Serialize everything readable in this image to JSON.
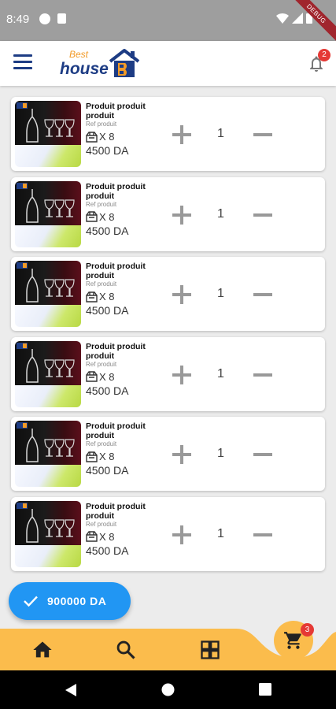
{
  "status_bar": {
    "time": "8:49",
    "debug_ribbon": "DEBUG"
  },
  "app_bar": {
    "logo_best": "Best",
    "logo_house": "house",
    "notification_count": "2"
  },
  "colors": {
    "brand_blue": "#1d3c84",
    "brand_orange": "#f29a26",
    "accent_blue": "#2196f3",
    "nav_yellow": "#fbbc4c",
    "badge_red": "#e53935"
  },
  "cart_items": [
    {
      "name": "Produit produit produit",
      "ref": "Ref produit",
      "pack_count": "X 8",
      "price": "4500 DA",
      "quantity": "1"
    },
    {
      "name": "Produit produit produit",
      "ref": "Ref produit",
      "pack_count": "X 8",
      "price": "4500 DA",
      "quantity": "1"
    },
    {
      "name": "Produit produit produit",
      "ref": "Ref produit",
      "pack_count": "X 8",
      "price": "4500 DA",
      "quantity": "1"
    },
    {
      "name": "Produit produit produit",
      "ref": "Ref produit",
      "pack_count": "X 8",
      "price": "4500 DA",
      "quantity": "1"
    },
    {
      "name": "Produit produit produit",
      "ref": "Ref produit",
      "pack_count": "X 8",
      "price": "4500 DA",
      "quantity": "1"
    },
    {
      "name": "Produit produit produit",
      "ref": "Ref produit",
      "pack_count": "X 8",
      "price": "4500 DA",
      "quantity": "1"
    }
  ],
  "total_button": {
    "label": "900000 DA",
    "icon": "check-icon"
  },
  "bottom_nav": {
    "items": [
      {
        "icon": "home-icon"
      },
      {
        "icon": "search-icon"
      },
      {
        "icon": "grid-icon"
      }
    ],
    "cart_icon": "cart-icon",
    "cart_count": "3"
  },
  "android_nav": {
    "items": [
      {
        "icon": "back-icon"
      },
      {
        "icon": "home-circle-icon"
      },
      {
        "icon": "recents-icon"
      }
    ]
  }
}
